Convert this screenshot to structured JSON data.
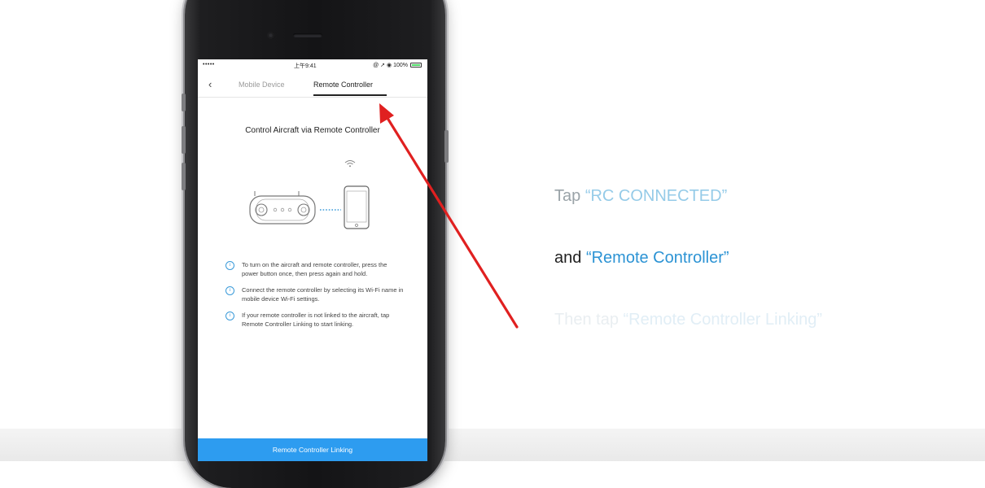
{
  "status_bar": {
    "left": "••••• ",
    "time": "上午9:41",
    "right": "@ ➚ ◉ 100%"
  },
  "nav": {
    "back_icon": "chevron-left",
    "tabs": [
      "Mobile Device",
      "Remote Controller"
    ],
    "active_tab": "Remote Controller"
  },
  "screen": {
    "title": "Control Aircraft via Remote Controller",
    "info_items": [
      "To turn on the aircraft and remote controller, press the power button once, then press again and hold.",
      "Connect the remote controller by selecting its Wi-Fi name in mobile device Wi-Fi settings.",
      "If your remote controller is not linked to the aircraft, tap Remote Controller Linking to start linking."
    ],
    "info_icon_glyph": "i",
    "button_label": "Remote Controller Linking"
  },
  "captions": [
    {
      "prefix": "Tap ",
      "highlight": "“RC CONNECTED”"
    },
    {
      "prefix": "and ",
      "highlight": "“Remote Controller”"
    },
    {
      "prefix": "Then tap ",
      "highlight": "“Remote Controller Linking”"
    }
  ],
  "colors": {
    "accent_blue": "#2d9cf0",
    "arrow_red": "#e02020"
  }
}
